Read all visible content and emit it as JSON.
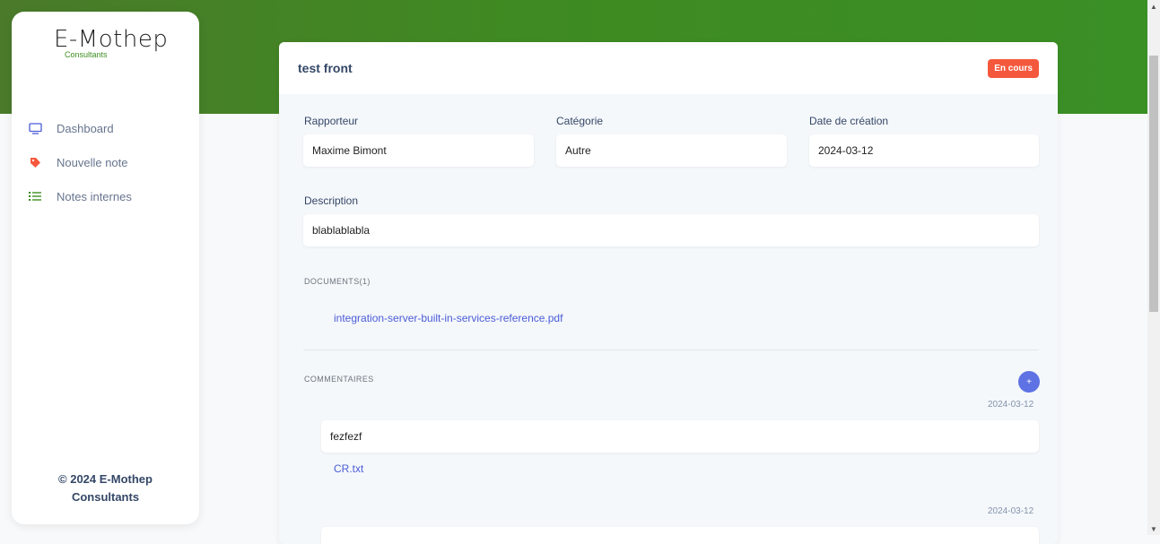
{
  "brand": {
    "name": "E-Mothep",
    "sub": "Consultants"
  },
  "nav": [
    {
      "label": "Dashboard",
      "icon": "monitor-icon"
    },
    {
      "label": "Nouvelle note",
      "icon": "tag-icon"
    },
    {
      "label": "Notes internes",
      "icon": "list-icon"
    }
  ],
  "footer": {
    "line1": "© 2024 E-Mothep",
    "line2": "Consultants"
  },
  "note": {
    "title": "test front",
    "status": "En cours",
    "fields": {
      "rapporteur_label": "Rapporteur",
      "rapporteur": "Maxime Bimont",
      "categorie_label": "Catégorie",
      "categorie": "Autre",
      "date_label": "Date de création",
      "date": "2024-03-12",
      "description_label": "Description",
      "description": "blablablabla"
    },
    "documents": {
      "title": "DOCUMENTS(1)",
      "files": [
        "integration-server-built-in-services-reference.pdf"
      ]
    },
    "comments": {
      "title": "COMMENTAIRES",
      "add_label": "+",
      "items": [
        {
          "date": "2024-03-12",
          "text": "fezfezf",
          "attachment": "CR.txt"
        },
        {
          "date": "2024-03-12",
          "text": "",
          "attachment": ""
        }
      ]
    }
  },
  "colors": {
    "accent": "#5e72e4",
    "badge": "#f5593d",
    "brand_green": "#3f8f22"
  }
}
